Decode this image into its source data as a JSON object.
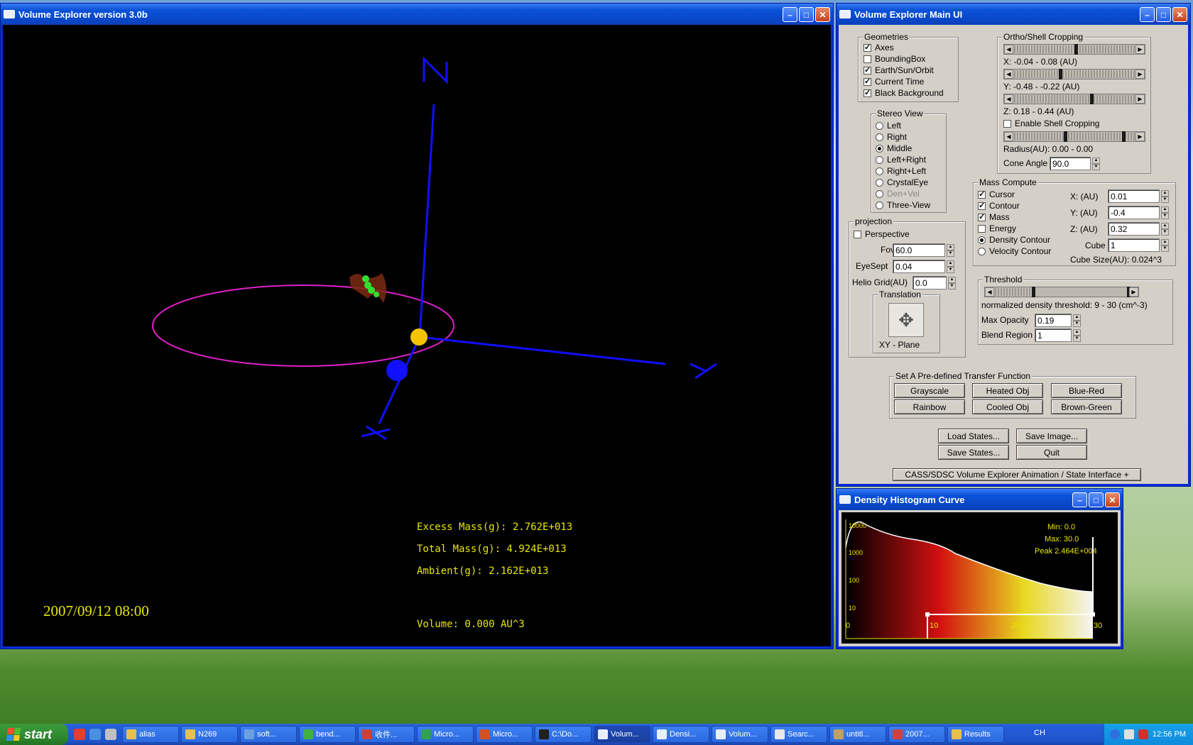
{
  "viewer": {
    "title": "Volume Explorer version 3.0b",
    "axis_labels": {
      "n": "N",
      "x": "X",
      "y": "Y"
    },
    "excess_mass": "Excess Mass(g): 2.762E+013",
    "total_mass": "Total Mass(g): 4.924E+013",
    "ambient": "Ambient(g): 2.162E+013",
    "volume": "Volume: 0.000 AU^3",
    "datetime": "2007/09/12 08:00"
  },
  "main_ui": {
    "title": "Volume Explorer Main UI",
    "geometries": {
      "label": "Geometries",
      "items": [
        {
          "label": "Axes",
          "checked": true
        },
        {
          "label": "BoundingBox",
          "checked": false
        },
        {
          "label": "Earth/Sun/Orbit",
          "checked": true
        },
        {
          "label": "Current Time",
          "checked": true
        },
        {
          "label": "Black Background",
          "checked": true
        }
      ]
    },
    "stereo": {
      "label": "Stereo View",
      "items": [
        {
          "label": "Left",
          "selected": false,
          "disabled": false
        },
        {
          "label": "Right",
          "selected": false,
          "disabled": false
        },
        {
          "label": "Middle",
          "selected": true,
          "disabled": false
        },
        {
          "label": "Left+Right",
          "selected": false,
          "disabled": false
        },
        {
          "label": "Right+Left",
          "selected": false,
          "disabled": false
        },
        {
          "label": "CrystalEye",
          "selected": false,
          "disabled": false
        },
        {
          "label": "Den+Vel",
          "selected": false,
          "disabled": true
        },
        {
          "label": "Three-View",
          "selected": false,
          "disabled": false
        }
      ]
    },
    "projection": {
      "label": "projection",
      "perspective": "Perspective",
      "fov_label": "Fov",
      "fov_value": "60.0",
      "eyesept_label": "EyeSept",
      "eyesept_value": "0.04",
      "helio_label": "Helio Grid(AU)",
      "helio_value": "0.0",
      "translation_label": "Translation",
      "plane": "XY - Plane"
    },
    "cropping": {
      "label": "Ortho/Shell Cropping",
      "x_range": "X: -0.04 - 0.08 (AU)",
      "y_range": "Y: -0.48 - -0.22 (AU)",
      "z_range": "Z: 0.18 - 0.44 (AU)",
      "shell": "Enable Shell Cropping",
      "radius": "Radius(AU): 0.00 - 0.00",
      "cone_label": "Cone Angle",
      "cone_value": "90.0"
    },
    "mass": {
      "label": "Mass Compute",
      "checks": [
        {
          "label": "Cursor",
          "checked": true
        },
        {
          "label": "Contour",
          "checked": true
        },
        {
          "label": "Mass",
          "checked": true
        },
        {
          "label": "Energy",
          "checked": false
        }
      ],
      "radios": [
        {
          "label": "Density Contour",
          "selected": true
        },
        {
          "label": "Velocity Contour",
          "selected": false
        }
      ],
      "x_label": "X: (AU)",
      "x_value": "0.01",
      "y_label": "Y: (AU)",
      "y_value": "-0.4",
      "z_label": "Z: (AU)",
      "z_value": "0.32",
      "cube_label": "Cube",
      "cube_value": "1",
      "cube_size": "Cube Size(AU): 0.024^3"
    },
    "threshold": {
      "label": "Threshold",
      "text": "normalized density threshold: 9 - 30 (cm^-3)",
      "opacity_label": "Max Opacity",
      "opacity_value": "0.19",
      "blend_label": "Blend Region",
      "blend_value": "1"
    },
    "transfer": {
      "label": "Set A Pre-defined Transfer Function",
      "buttons": [
        "Grayscale",
        "Heated Obj",
        "Blue-Red",
        "Rainbow",
        "Cooled Obj",
        "Brown-Green"
      ]
    },
    "actions": {
      "load": "Load States...",
      "save_image": "Save Image...",
      "save_states": "Save States...",
      "quit": "Quit"
    },
    "animation_bar": "CASS/SDSC Volume Explorer Animation / State Interface +"
  },
  "histogram": {
    "title": "Density Histogram Curve",
    "min": "Min: 0.0",
    "max": "Max: 30.0",
    "peak": "Peak 2.464E+004",
    "y_ticks": [
      "10000",
      "1000",
      "100",
      "10"
    ],
    "x_ticks": [
      "0",
      "10",
      "20",
      "30"
    ]
  },
  "taskbar": {
    "start": "start",
    "tasks": [
      {
        "label": "alias",
        "color": "#e8c050",
        "active": false
      },
      {
        "label": "N269",
        "color": "#e8c050",
        "active": false
      },
      {
        "label": "soft...",
        "color": "#6aa0e0",
        "active": false
      },
      {
        "label": "bend...",
        "color": "#40b040",
        "active": false
      },
      {
        "label": "收件...",
        "color": "#d04030",
        "active": false
      },
      {
        "label": "Micro...",
        "color": "#30a050",
        "active": false
      },
      {
        "label": "Micro...",
        "color": "#d05020",
        "active": false
      },
      {
        "label": "C:\\Do...",
        "color": "#202020",
        "active": false
      },
      {
        "label": "Volum...",
        "color": "#e8eefc",
        "active": true
      },
      {
        "label": "Densi...",
        "color": "#e8eefc",
        "active": false
      },
      {
        "label": "Volum...",
        "color": "#e8eefc",
        "active": false
      },
      {
        "label": "Searc...",
        "color": "#e8e8e8",
        "active": false
      },
      {
        "label": "untitl...",
        "color": "#c0a060",
        "active": false
      },
      {
        "label": "2007...",
        "color": "#d04040",
        "active": false
      },
      {
        "label": "Results",
        "color": "#e8c050",
        "active": false
      }
    ],
    "lang": "CH",
    "clock": "12:56 PM"
  }
}
